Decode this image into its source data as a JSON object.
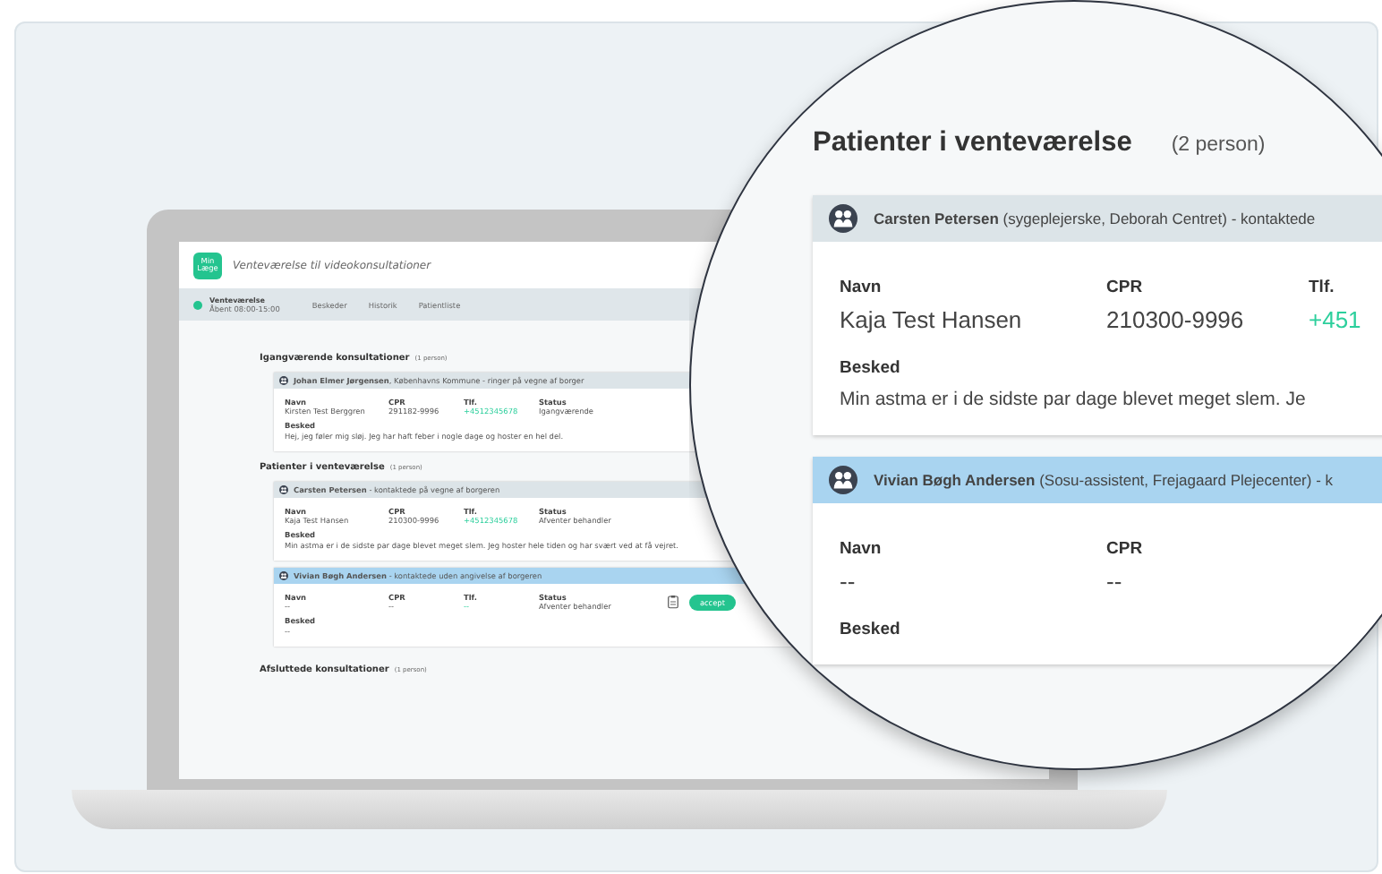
{
  "app": {
    "logo": "Min Læge",
    "title": "Venteværelse til videokonsultationer"
  },
  "status": {
    "label": "Venteværelse",
    "hours": "Åbent 08:00-15:00",
    "online": true
  },
  "tabs": [
    {
      "label": "Beskeder",
      "selected": false
    },
    {
      "label": "Historik",
      "selected": false
    },
    {
      "label": "Patientliste",
      "selected": false
    }
  ],
  "sections": [
    {
      "kind": "list",
      "title": "Igangværende konsultationer",
      "count": "(1 person)",
      "cards": [
        {
          "header": "**Johan Elmer Jørgensen**, Københavns Kommune - ringer på vegne af borger",
          "highlight": false,
          "fields": [
            {
              "label": "Navn",
              "value": "Kirsten Test Berggren",
              "kind": "text"
            },
            {
              "label": "CPR",
              "value": "291182-9996",
              "kind": "text"
            },
            {
              "label": "Tlf.",
              "value": "+4512345678",
              "kind": "phone"
            },
            {
              "label": "Status",
              "value": "Igangværende",
              "kind": "text"
            }
          ],
          "message_label": "Besked",
          "message": "Hej, jeg føler mig sløj. Jeg har haft feber i nogle dage og hoster en hel del."
        }
      ]
    },
    {
      "kind": "list",
      "title": "Patienter i venteværelse",
      "count": "(1 person)",
      "cards": [
        {
          "header": "**Carsten Petersen** - kontaktede på vegne af borgeren",
          "highlight": false,
          "fields": [
            {
              "label": "Navn",
              "value": "Kaja Test Hansen",
              "kind": "text"
            },
            {
              "label": "CPR",
              "value": "210300-9996",
              "kind": "text"
            },
            {
              "label": "Tlf.",
              "value": "+4512345678",
              "kind": "phone"
            },
            {
              "label": "Status",
              "value": "Afventer behandler",
              "kind": "text"
            }
          ],
          "message_label": "Besked",
          "message": "Min astma er i de sidste par dage blevet meget slem. Jeg hoster hele tiden og har svært ved at få vejret."
        },
        {
          "header": "**Vivian Bøgh Andersen** - kontaktede uden angivelse af borgeren",
          "highlight": true,
          "fields": [
            {
              "label": "Navn",
              "value": "--",
              "kind": "text"
            },
            {
              "label": "CPR",
              "value": "--",
              "kind": "text"
            },
            {
              "label": "Tlf.",
              "value": "--",
              "kind": "phone"
            },
            {
              "label": "Status",
              "value": "Afventer behandler",
              "kind": "text"
            }
          ],
          "message_label": "Besked",
          "message": "--",
          "accept": "accept"
        }
      ]
    },
    {
      "kind": "collapsed",
      "title": "Afsluttede konsultationer",
      "count": "(1 person)"
    }
  ],
  "magnifier": {
    "title": "Patienter i venteværelse",
    "count": "(2 person)",
    "cards": [
      {
        "header": "**Carsten Petersen** (sygeplejerske, Deborah Centret) - kontaktede",
        "highlight": false,
        "fields": [
          {
            "label": "Navn",
            "value": "Kaja Test Hansen",
            "kind": "text"
          },
          {
            "label": "CPR",
            "value": "210300-9996",
            "kind": "text"
          },
          {
            "label": "Tlf.",
            "value": "+451",
            "kind": "phone"
          }
        ],
        "message_label": "Besked",
        "message": "Min astma er i de sidste par dage blevet meget slem. Je"
      },
      {
        "header": "**Vivian Bøgh Andersen** (Sosu-assistent, Frejagaard Plejecenter) - k",
        "highlight": true,
        "fields": [
          {
            "label": "Navn",
            "value": "--",
            "kind": "text"
          },
          {
            "label": "CPR",
            "value": "--",
            "kind": "text"
          }
        ],
        "message_label": "Besked"
      }
    ]
  }
}
